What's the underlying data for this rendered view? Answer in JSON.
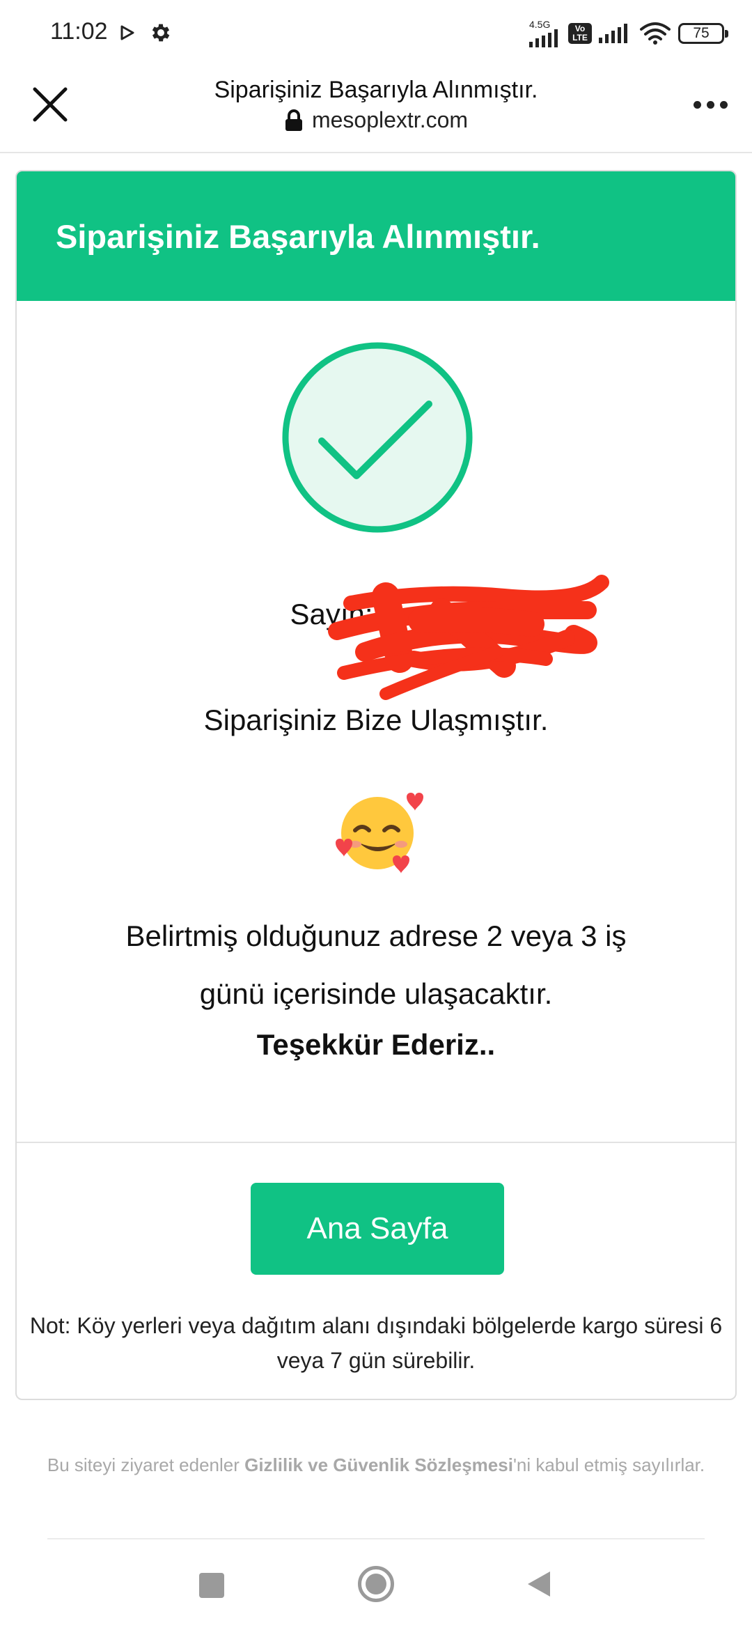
{
  "status_bar": {
    "time": "11:02",
    "network": "4.5G",
    "volte_top": "Vo",
    "volte_bottom": "LTE",
    "battery": "75"
  },
  "browser": {
    "title": "Siparişiniz Başarıyla Alınmıştır.",
    "url": "mesoplextr.com"
  },
  "card": {
    "header_title": "Siparişiniz Başarıyla Alınmıştır.",
    "greeting_label": "Sayın:",
    "received": "Siparişiniz Bize Ulaşmıştır.",
    "emoji": "🥰",
    "delivery_line1": "Belirtmiş olduğunuz adrese 2 veya 3 iş",
    "delivery_line2": "günü içerisinde ulaşacaktır.",
    "thanks": "Teşekkür Ederiz..",
    "home_button": "Ana Sayfa",
    "note": "Not: Köy yerleri veya dağıtım alanı dışındaki bölgelerde kargo süresi 6 veya 7 gün sürebilir."
  },
  "footer": {
    "prefix": "Bu siteyi ziyaret edenler ",
    "link": "Gizlilik ve Güvenlik Sözleşmesi",
    "suffix": "'ni kabul etmiş sayılırlar."
  },
  "colors": {
    "accent": "#10c284",
    "check_fill": "#e6f8f0",
    "redaction": "#f5311a"
  },
  "icons": [
    "play-icon",
    "gear-icon",
    "signal-icon",
    "wifi-icon",
    "battery-icon",
    "close-icon",
    "lock-icon",
    "more-icon",
    "checkmark-icon",
    "smiling-face-with-hearts-emoji",
    "recents-icon",
    "home-icon",
    "back-icon"
  ]
}
